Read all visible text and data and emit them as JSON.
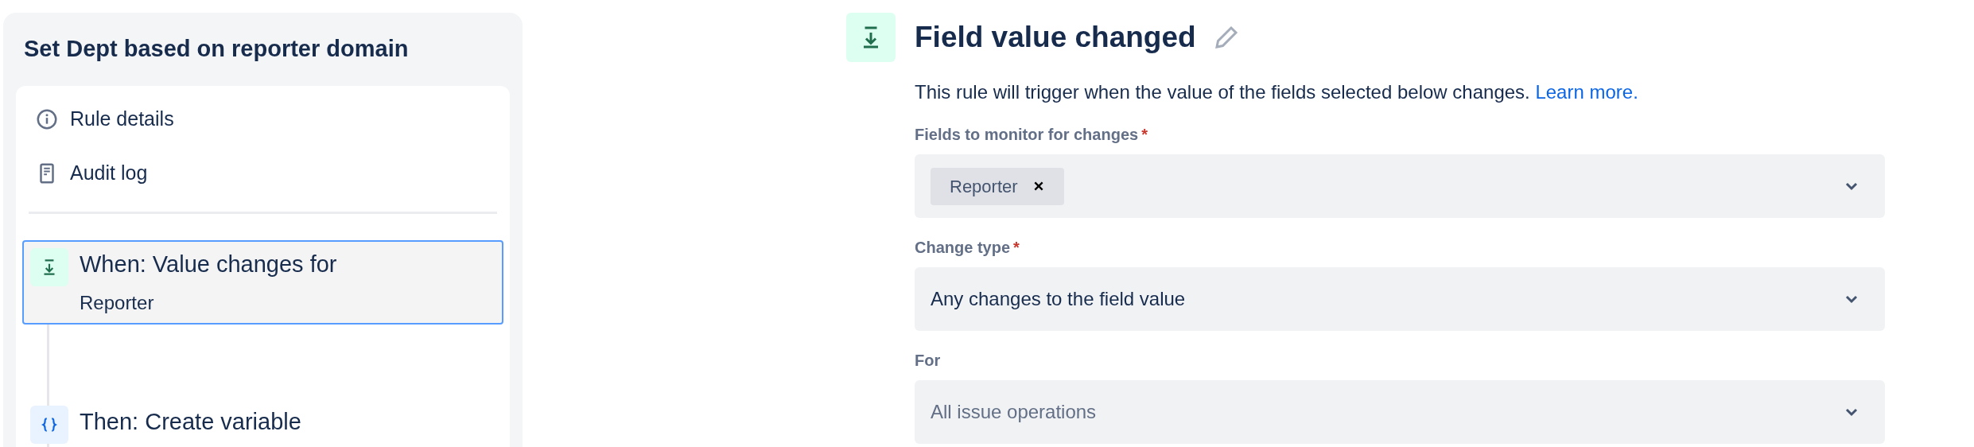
{
  "sidebar": {
    "title": "Set Dept based on reporter domain",
    "links": [
      {
        "kind": "info",
        "label": "Rule details"
      },
      {
        "kind": "log",
        "label": "Audit log"
      }
    ],
    "steps": [
      {
        "kind": "trigger",
        "label": "When: Value changes for",
        "detail": "Reporter",
        "selected": true
      },
      {
        "kind": "action",
        "label": "Then: Create variable",
        "selected": false
      }
    ]
  },
  "panel": {
    "title": "Field value changed",
    "description": "This rule will trigger when the value of the fields selected below changes.",
    "link": "Learn more.",
    "fields": [
      {
        "kind": "tags",
        "label": "Fields to monitor for changes",
        "required_mark": "*",
        "tags": [
          "Reporter"
        ]
      },
      {
        "kind": "select",
        "label": "Change type",
        "required_mark": "*",
        "value": "Any changes to the field value"
      },
      {
        "kind": "select",
        "label": "For",
        "placeholder": "All issue operations"
      }
    ]
  }
}
